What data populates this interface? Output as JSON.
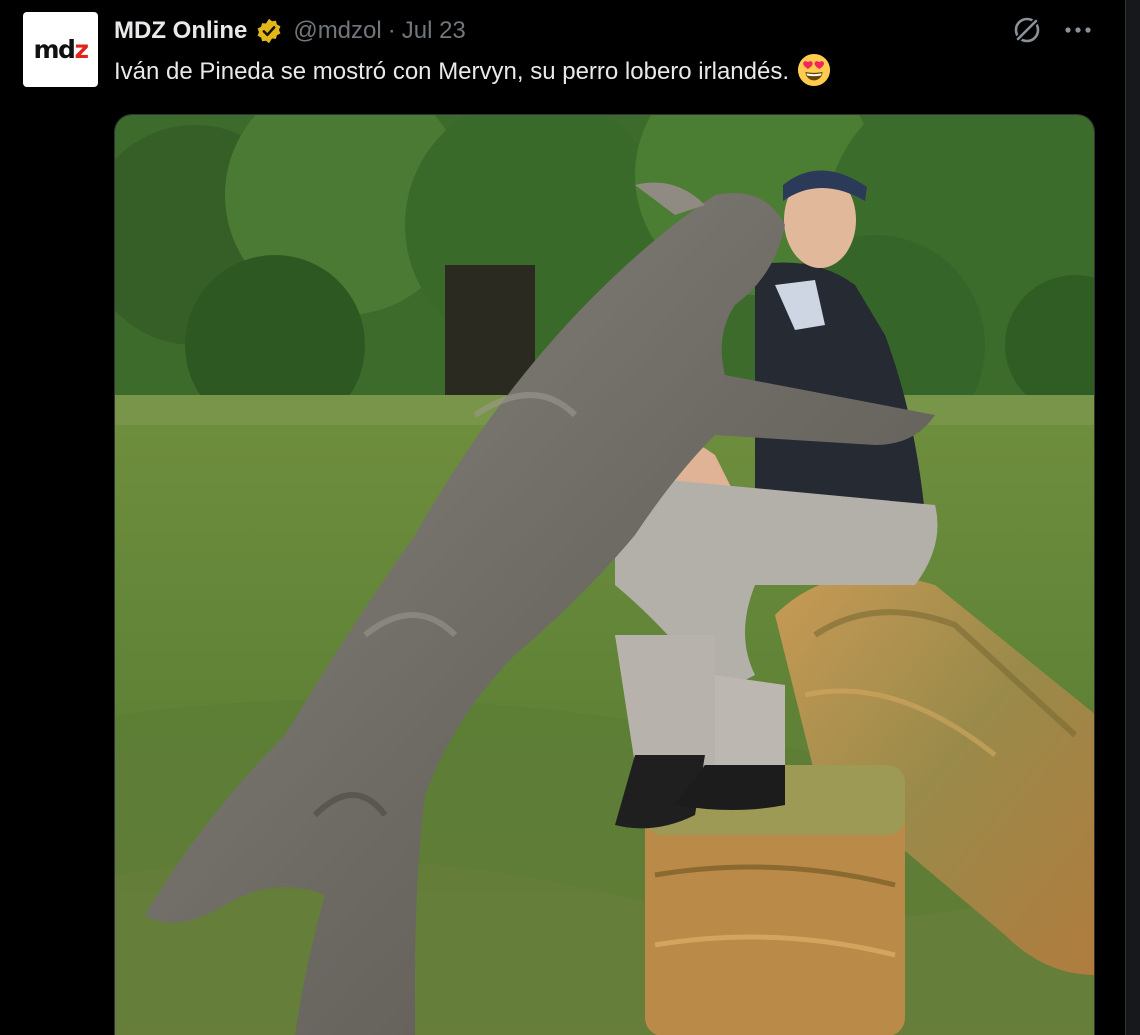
{
  "tweet": {
    "avatar": {
      "logo_text_main": "md",
      "logo_text_accent": "z",
      "logo_accent_color": "#e0241b"
    },
    "display_name": "MDZ Online",
    "verified_badge": "gold-verified-badge-icon",
    "handle": "@mdzol",
    "separator": "·",
    "date": "Jul 23",
    "text": "Iván de Pineda se mostró con Mervyn, su perro lobero irlandés.",
    "text_emoji": "smiling-face-with-heart-eyes-icon",
    "actions": {
      "grok": "grok-icon",
      "more": "more-options-icon"
    },
    "media": {
      "type": "photo",
      "subject_icon": "photo-man-with-irish-wolfhound"
    }
  },
  "colors": {
    "background": "#000000",
    "text_primary": "#e7e9ea",
    "text_secondary": "#71767b",
    "verified_gold": "#e2b719",
    "border": "#2f3336"
  }
}
